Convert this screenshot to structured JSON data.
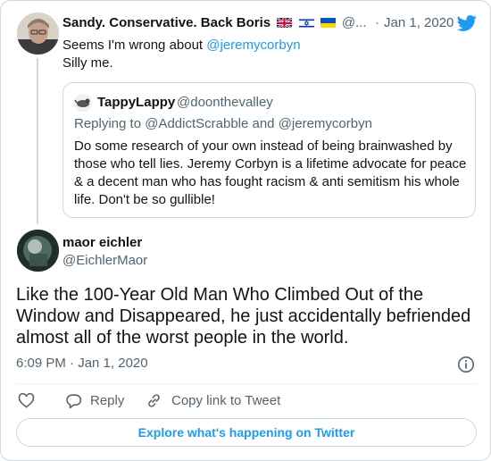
{
  "parent_tweet": {
    "name": "Sandy. Conservative. Back Boris",
    "flags": [
      "uk-flag-icon",
      "israel-flag-icon",
      "ukraine-flag-icon"
    ],
    "handle": "@...",
    "dot": "·",
    "date": "Jan 1, 2020",
    "text_before_mention": "Seems I'm wrong about ",
    "mention": "@jeremycorbyn",
    "text_line2": "Silly me."
  },
  "quoted_tweet": {
    "name": "TappyLappy",
    "handle": "@doonthevalley",
    "replying_to": "Replying to @AddictScrabble and @jeremycorbyn",
    "text": "Do some research of your own instead of being brainwashed by those who tell lies. Jeremy Corbyn is a lifetime advocate for peace & a decent man who has fought racism & anti semitism his whole life. Don't be so gullible!"
  },
  "main_tweet": {
    "name": "maor eichler",
    "handle": "@EichlerMaor",
    "text": "Like the 100-Year Old Man Who Climbed Out of the Window and Disappeared, he just accidentally befriended almost all of the worst people in the world.",
    "timestamp": "6:09 PM · Jan 1, 2020"
  },
  "actions": {
    "reply_label": "Reply",
    "copy_link_label": "Copy link to Tweet"
  },
  "explore_button": "Explore what's happening on Twitter",
  "colors": {
    "accent": "#1d9bf0",
    "text": "#0f1419",
    "secondary": "#536471",
    "border": "#cfd9de"
  }
}
